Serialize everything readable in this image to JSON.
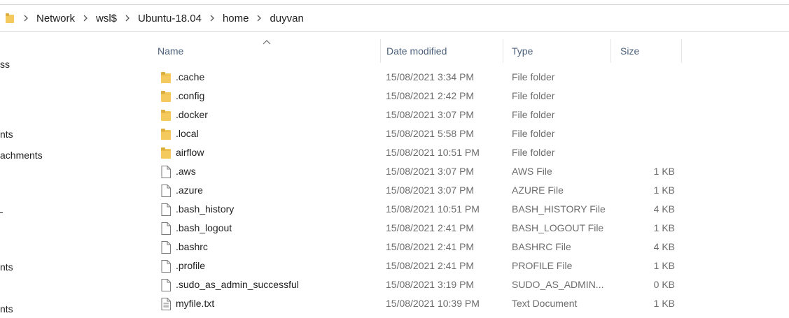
{
  "breadcrumb": [
    "Network",
    "wsl$",
    "Ubuntu-18.04",
    "home",
    "duyvan"
  ],
  "nav": [
    "ss",
    "nts",
    "achments",
    "nts",
    "nts"
  ],
  "columns": {
    "name": "Name",
    "date": "Date modified",
    "type": "Type",
    "size": "Size"
  },
  "files": [
    {
      "icon": "folder-icon",
      "name": ".cache",
      "date": "15/08/2021 3:34 PM",
      "type": "File folder",
      "size": ""
    },
    {
      "icon": "folder-icon",
      "name": ".config",
      "date": "15/08/2021 2:42 PM",
      "type": "File folder",
      "size": ""
    },
    {
      "icon": "folder-icon",
      "name": ".docker",
      "date": "15/08/2021 3:07 PM",
      "type": "File folder",
      "size": ""
    },
    {
      "icon": "folder-icon",
      "name": ".local",
      "date": "15/08/2021 5:58 PM",
      "type": "File folder",
      "size": ""
    },
    {
      "icon": "folder-icon",
      "name": "airflow",
      "date": "15/08/2021 10:51 PM",
      "type": "File folder",
      "size": ""
    },
    {
      "icon": "file-icon",
      "name": ".aws",
      "date": "15/08/2021 3:07 PM",
      "type": "AWS File",
      "size": "1 KB"
    },
    {
      "icon": "file-icon",
      "name": ".azure",
      "date": "15/08/2021 3:07 PM",
      "type": "AZURE File",
      "size": "1 KB"
    },
    {
      "icon": "file-icon",
      "name": ".bash_history",
      "date": "15/08/2021 10:51 PM",
      "type": "BASH_HISTORY File",
      "size": "4 KB"
    },
    {
      "icon": "file-icon",
      "name": ".bash_logout",
      "date": "15/08/2021 2:41 PM",
      "type": "BASH_LOGOUT File",
      "size": "1 KB"
    },
    {
      "icon": "file-icon",
      "name": ".bashrc",
      "date": "15/08/2021 2:41 PM",
      "type": "BASHRC File",
      "size": "4 KB"
    },
    {
      "icon": "file-icon",
      "name": ".profile",
      "date": "15/08/2021 2:41 PM",
      "type": "PROFILE File",
      "size": "1 KB"
    },
    {
      "icon": "file-icon",
      "name": ".sudo_as_admin_successful",
      "date": "15/08/2021 3:19 PM",
      "type": "SUDO_AS_ADMIN...",
      "size": "0 KB"
    },
    {
      "icon": "text-document-icon",
      "name": "myfile.txt",
      "date": "15/08/2021 10:39 PM",
      "type": "Text Document",
      "size": "1 KB"
    }
  ],
  "colors": {
    "folder": "#f4c95d",
    "folder_dark": "#dcae3f",
    "header_text": "#4c607a",
    "secondary_text": "#6d6d6d"
  }
}
